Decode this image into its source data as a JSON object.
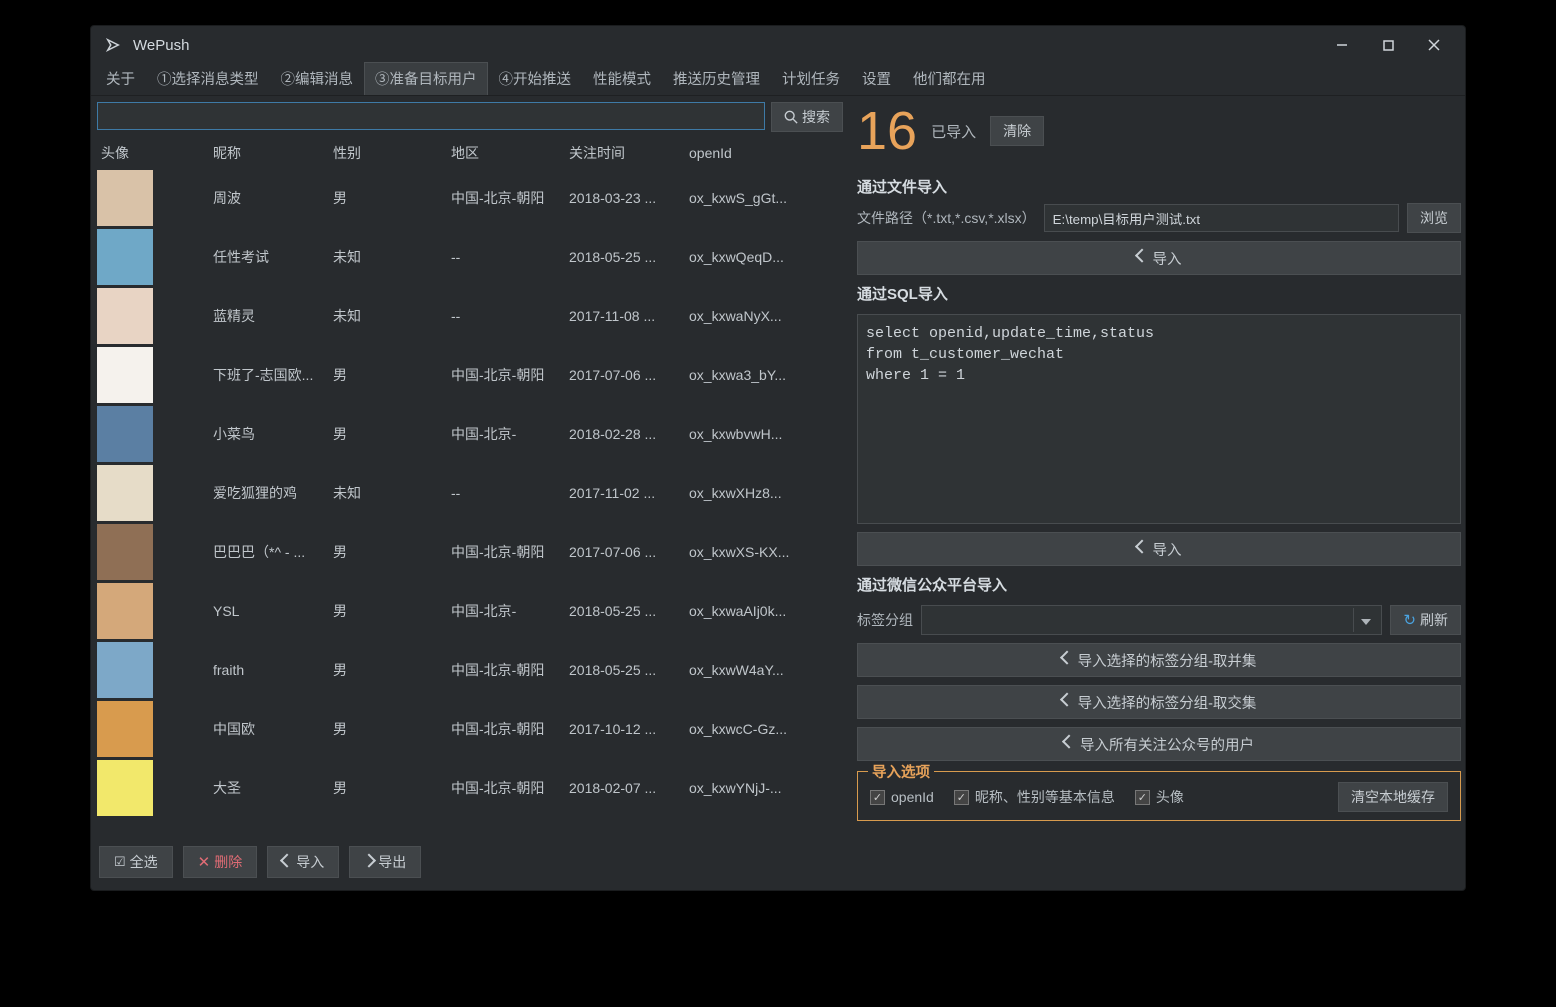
{
  "app": {
    "title": "WePush"
  },
  "tabs": [
    "关于",
    "①选择消息类型",
    "②编辑消息",
    "③准备目标用户",
    "④开始推送",
    "性能模式",
    "推送历史管理",
    "计划任务",
    "设置",
    "他们都在用"
  ],
  "active_tab": 3,
  "search": {
    "button": "搜索"
  },
  "table": {
    "headers": [
      "头像",
      "昵称",
      "性别",
      "地区",
      "关注时间",
      "openId"
    ],
    "rows": [
      {
        "avatar_bg": "#d9c2a8",
        "nickname": "周波",
        "gender": "男",
        "region": "中国-北京-朝阳",
        "time": "2018-03-23 ...",
        "openid": "ox_kxwS_gGt..."
      },
      {
        "avatar_bg": "#6fa8c7",
        "nickname": "任性考试",
        "gender": "未知",
        "region": "--",
        "time": "2018-05-25 ...",
        "openid": "ox_kxwQeqD..."
      },
      {
        "avatar_bg": "#e8d4c4",
        "nickname": "蓝精灵",
        "gender": "未知",
        "region": "--",
        "time": "2017-11-08 ...",
        "openid": "ox_kxwaNyX..."
      },
      {
        "avatar_bg": "#f5f2ed",
        "nickname": "下班了-志国欧...",
        "gender": "男",
        "region": "中国-北京-朝阳",
        "time": "2017-07-06 ...",
        "openid": "ox_kxwa3_bY..."
      },
      {
        "avatar_bg": "#5b7fa3",
        "nickname": "小菜鸟",
        "gender": "男",
        "region": "中国-北京-",
        "time": "2018-02-28 ...",
        "openid": "ox_kxwbvwH..."
      },
      {
        "avatar_bg": "#e6dcc8",
        "nickname": "爱吃狐狸的鸡",
        "gender": "未知",
        "region": "--",
        "time": "2017-11-02 ...",
        "openid": "ox_kxwXHz8..."
      },
      {
        "avatar_bg": "#8f6f55",
        "nickname": "巴巴巴（*^ - ...",
        "gender": "男",
        "region": "中国-北京-朝阳",
        "time": "2017-07-06 ...",
        "openid": "ox_kxwXS-KX..."
      },
      {
        "avatar_bg": "#d4a87a",
        "nickname": "YSL",
        "gender": "男",
        "region": "中国-北京-",
        "time": "2018-05-25 ...",
        "openid": "ox_kxwaAIj0k..."
      },
      {
        "avatar_bg": "#7da8c8",
        "nickname": "fraith",
        "gender": "男",
        "region": "中国-北京-朝阳",
        "time": "2018-05-25 ...",
        "openid": "ox_kxwW4aY..."
      },
      {
        "avatar_bg": "#d89b4e",
        "nickname": "中国欧",
        "gender": "男",
        "region": "中国-北京-朝阳",
        "time": "2017-10-12 ...",
        "openid": "ox_kxwcC-Gz..."
      },
      {
        "avatar_bg": "#f2e86b",
        "nickname": "大圣",
        "gender": "男",
        "region": "中国-北京-朝阳",
        "time": "2018-02-07 ...",
        "openid": "ox_kxwYNjJ-..."
      }
    ]
  },
  "left_footer": {
    "select_all": "全选",
    "delete": "删除",
    "import": "导入",
    "export": "导出"
  },
  "right": {
    "count": "16",
    "count_label": "已导入",
    "clear": "清除",
    "file_section": "通过文件导入",
    "file_label": "文件路径（*.txt,*.csv,*.xlsx）",
    "file_value": "E:\\temp\\目标用户测试.txt",
    "browse": "浏览",
    "import": "导入",
    "sql_section": "通过SQL导入",
    "sql_value": "select openid,update_time,status\nfrom t_customer_wechat\nwhere 1 = 1",
    "wechat_section": "通过微信公众平台导入",
    "tag_label": "标签分组",
    "refresh": "刷新",
    "import_tag_union": "导入选择的标签分组-取并集",
    "import_tag_intersect": "导入选择的标签分组-取交集",
    "import_all_followers": "导入所有关注公众号的用户",
    "options_legend": "导入选项",
    "opt_openid": "openId",
    "opt_basic": "昵称、性别等基本信息",
    "opt_avatar": "头像",
    "clear_cache": "清空本地缓存"
  }
}
